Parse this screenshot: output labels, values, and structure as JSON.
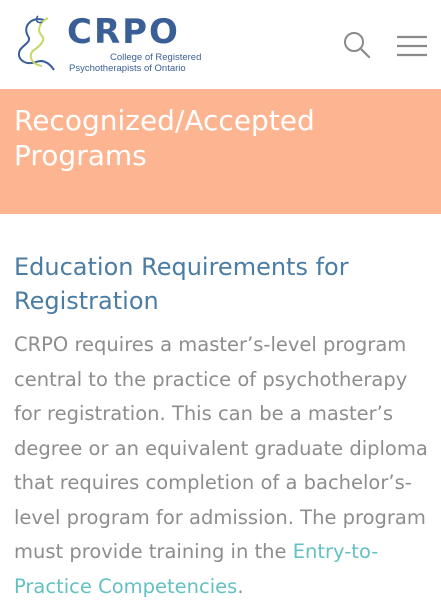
{
  "header": {
    "logo": {
      "wordmark": "CRPO",
      "subtitle_line1": "College of Registered",
      "subtitle_line2": "Psychotherapists of Ontario",
      "brand_color": "#3a5f96",
      "accent_color": "#c9d66a"
    },
    "search_icon": "search-icon",
    "menu_icon": "hamburger-menu-icon"
  },
  "banner": {
    "title": "Recognized/Accepted Programs",
    "background": "#fdb491"
  },
  "section": {
    "heading": "Education Requirements for Registration",
    "paragraph_text": "CRPO requires a master’s-level program central to the practice of psychotherapy for registration. This can be a master’s degree or an equivalent graduate diploma that requires completion of a bachelor’s-level program for admission. The program must provide training in the ",
    "link_text": "Entry-to-Practice Competencies",
    "paragraph_end": ".",
    "heading_color": "#4b7ca3",
    "link_color": "#63c1c4"
  }
}
